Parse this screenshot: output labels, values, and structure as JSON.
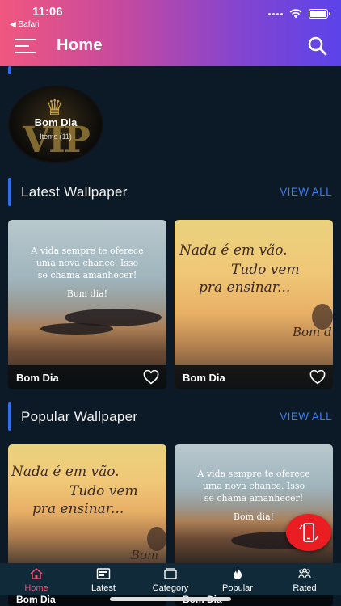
{
  "status_bar": {
    "time": "11:06",
    "back_label": "◀ Safari"
  },
  "header": {
    "title": "Home"
  },
  "featured_category": {
    "name": "Bom Dia",
    "items_label": "Items (11)",
    "badge_text": "VIP"
  },
  "latest": {
    "title": "Latest Wallpaper",
    "view_all": "VIEW ALL",
    "cards": [
      {
        "name": "Bom Dia",
        "quote": [
          "A vida sempre te oferece",
          "uma nova chance. Isso",
          "se chama amanhecer!",
          "",
          "Bom dia!"
        ]
      },
      {
        "name": "Bom Dia",
        "quote": [
          "Nada é em vão.",
          "Tudo vem",
          "pra ensinar..."
        ],
        "signature": "Bom d"
      }
    ]
  },
  "popular": {
    "title": "Popular Wallpaper",
    "view_all": "VIEW ALL",
    "cards": [
      {
        "name": "Bom Dia",
        "quote": [
          "Nada é em vão.",
          "Tudo vem",
          "pra ensinar..."
        ],
        "signature": "Bom"
      },
      {
        "name": "Bom Dia",
        "quote": [
          "A vida sempre te oferece",
          "uma nova chance. Isso",
          "se chama amanhecer!",
          "",
          "Bom dia!"
        ]
      }
    ]
  },
  "bottom_nav": [
    {
      "label": "Home",
      "icon": "home-icon",
      "active": true
    },
    {
      "label": "Latest",
      "icon": "latest-icon",
      "active": false
    },
    {
      "label": "Category",
      "icon": "category-icon",
      "active": false
    },
    {
      "label": "Popular",
      "icon": "fire-icon",
      "active": false
    },
    {
      "label": "Rated",
      "icon": "rated-icon",
      "active": false
    }
  ],
  "colors": {
    "accent": "#2f6df5",
    "active_nav": "#ef4d73",
    "fab": "#ea1d23"
  }
}
